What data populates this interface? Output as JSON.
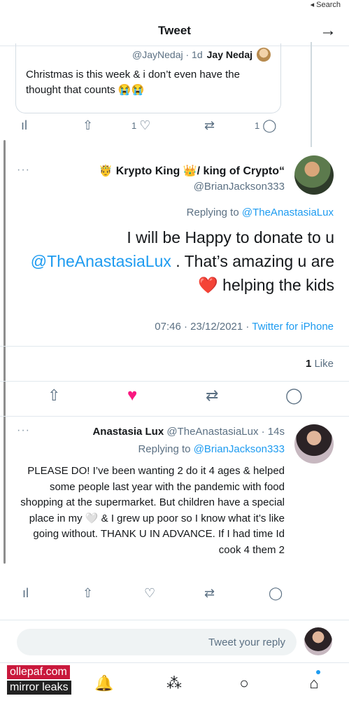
{
  "status": {
    "back_app": "◂ Search"
  },
  "header": {
    "title": "Tweet",
    "arrow": "→"
  },
  "quoted": {
    "name": "Jay Nedaj",
    "handle": "@JayNedaj · 1d",
    "text": "Christmas is this week & i don’t even have the thought that counts 😭😭"
  },
  "quoted_actions": {
    "reply_count": "1",
    "retweet_count": "",
    "like_count": "1"
  },
  "main": {
    "name": "“Krypto King 👑/ king of Crypto 🤴",
    "handle": "@BrianJackson333",
    "replying_prefix": "Replying to ",
    "replying_handle": "@TheAnastasiaLux",
    "text_part1": "I will be Happy to donate to u ",
    "text_mention": "@TheAnastasiaLux",
    "text_part2": " . That’s amazing u are helping the kids ❤️",
    "time": "07:46 · 23/12/2021 · ",
    "client": "Twitter for iPhone",
    "likes_count": "1",
    "likes_label": "Like"
  },
  "reply": {
    "name": "Anastasia Lux",
    "handle_time": "@TheAnastasiaLux · 14s",
    "replying_prefix": "Replying to ",
    "replying_handle": "@BrianJackson333",
    "text": "PLEASE DO! I’ve been wanting 2 do it 4 ages & helped some people last year with the pandemic with food shopping at the supermarket. But children have a special place in my 🤍 & I grew up poor so I know what it’s like going without. THANK U IN ADVANCE. If I had time Id cook 4 them 2"
  },
  "composer": {
    "placeholder": "Tweet your reply"
  },
  "watermark": {
    "line1": "ollepaf.com",
    "line2": "mirror leaks"
  },
  "colors": {
    "link": "#1d9bf0",
    "like_active": "#f91880",
    "muted": "#5b7083"
  }
}
